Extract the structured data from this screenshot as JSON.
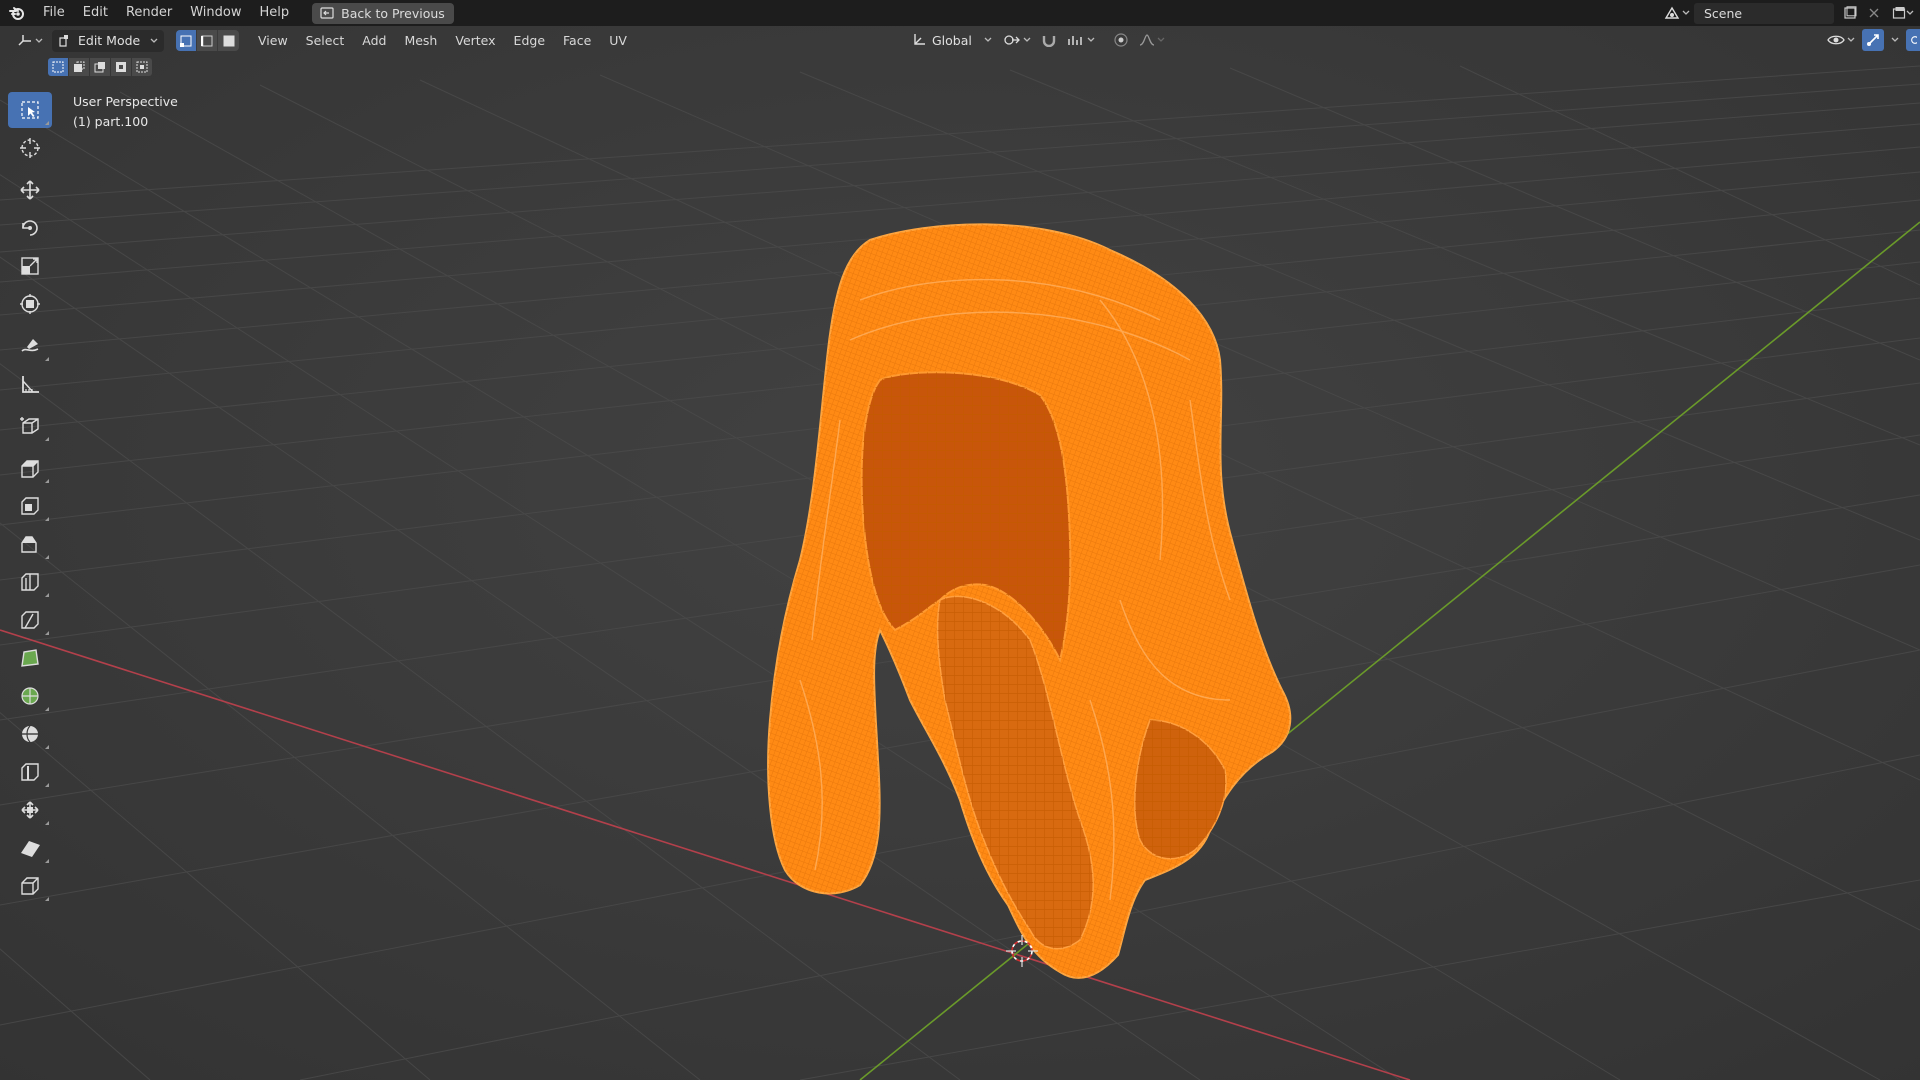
{
  "app": {
    "logo": "blender-icon"
  },
  "menu": {
    "items": [
      "File",
      "Edit",
      "Render",
      "Window",
      "Help"
    ],
    "back_button": "Back to Previous"
  },
  "scene": {
    "label": "Scene"
  },
  "viewport_header": {
    "mode": "Edit Mode",
    "menus": [
      "View",
      "Select",
      "Add",
      "Mesh",
      "Vertex",
      "Edge",
      "Face",
      "UV"
    ],
    "transform_orientation": "Global"
  },
  "viewport": {
    "view_name": "User Perspective",
    "object_info": "(1) part.100"
  },
  "toolbar": {
    "tools": [
      "select-box-icon",
      "cursor-icon",
      "move-icon",
      "rotate-icon",
      "scale-icon",
      "transform-icon",
      "annotate-icon",
      "measure-icon",
      "add-cube-icon",
      "extrude-icon",
      "inset-icon",
      "bevel-icon",
      "loop-cut-icon",
      "knife-icon",
      "poly-build-icon",
      "spin-icon",
      "smooth-icon",
      "edge-slide-icon",
      "shrink-fatten-icon",
      "shear-icon",
      "rip-icon"
    ],
    "active_tool": "select-box-icon"
  },
  "colors": {
    "accent": "#4772b3",
    "selection_orange": "#ff8c1a",
    "x_axis": "#b3404b",
    "y_axis": "#6a9a2a",
    "grid_bg": "#3a3a3a"
  }
}
